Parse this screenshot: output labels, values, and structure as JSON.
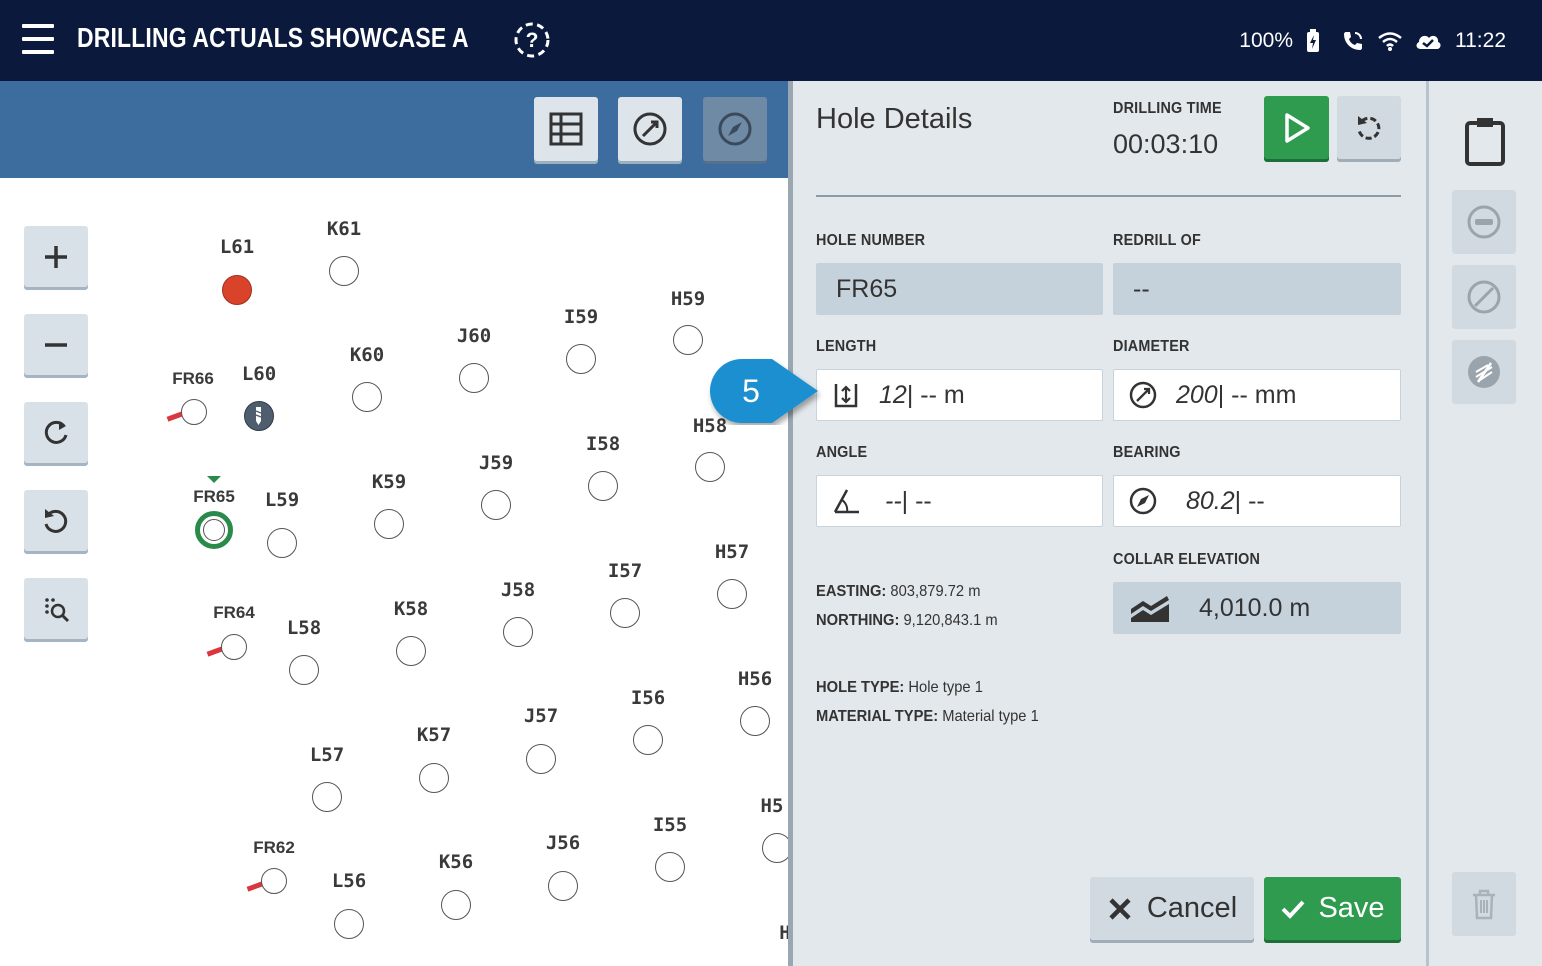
{
  "header": {
    "title": "DRILLING ACTUALS SHOWCASE A",
    "battery": "100%",
    "time": "11:22",
    "icons": [
      "menu-icon",
      "help-icon",
      "battery-icon",
      "phone-icon",
      "wifi-icon",
      "cloud-sync-icon"
    ]
  },
  "map": {
    "toolbar_icons": [
      "grid-icon",
      "diameter-icon",
      "compass-icon"
    ],
    "controls": [
      "zoom-in-icon",
      "zoom-out-icon",
      "redo-icon",
      "undo-icon",
      "zoom-search-icon"
    ],
    "holes": [
      {
        "label": "L61",
        "state": "drilled-red"
      },
      {
        "label": "K61"
      },
      {
        "label": "H59"
      },
      {
        "label": "I59"
      },
      {
        "label": "J60"
      },
      {
        "label": "K60"
      },
      {
        "label": "L60",
        "state": "drilling"
      },
      {
        "label": "FR66",
        "state": "redrill"
      },
      {
        "label": "H58"
      },
      {
        "label": "I58"
      },
      {
        "label": "J59"
      },
      {
        "label": "K59"
      },
      {
        "label": "L59"
      },
      {
        "label": "FR65",
        "state": "selected"
      },
      {
        "label": "H57"
      },
      {
        "label": "I57"
      },
      {
        "label": "J58"
      },
      {
        "label": "K58"
      },
      {
        "label": "L58"
      },
      {
        "label": "FR64",
        "state": "redrill"
      },
      {
        "label": "H56"
      },
      {
        "label": "I56"
      },
      {
        "label": "J57"
      },
      {
        "label": "K57"
      },
      {
        "label": "L57"
      },
      {
        "label": "H5"
      },
      {
        "label": "I55"
      },
      {
        "label": "J56"
      },
      {
        "label": "K56"
      },
      {
        "label": "L56"
      },
      {
        "label": "FR62",
        "state": "redrill"
      },
      {
        "label": "H"
      }
    ]
  },
  "panel": {
    "title": "Hole Details",
    "drilling_time_caption": "DRILLING TIME",
    "drilling_time": "00:03:10",
    "hole_number_caption": "HOLE NUMBER",
    "hole_number": "FR65",
    "redrill_caption": "REDRILL OF",
    "redrill": "--",
    "length_caption": "LENGTH",
    "length_value": "12",
    "length_rest": " | -- m",
    "diameter_caption": "DIAMETER",
    "diameter_value": "200",
    "diameter_rest": " | -- mm",
    "angle_caption": "ANGLE",
    "angle_value": "--",
    "angle_rest": " | --",
    "bearing_caption": "BEARING",
    "bearing_value": "80.2",
    "bearing_rest": " | --",
    "collar_caption": "COLLAR ELEVATION",
    "collar_value": "4,010.0 m",
    "easting_label": "EASTING:",
    "easting_value": "803,879.72 m",
    "northing_label": "NORTHING:",
    "northing_value": "9,120,843.1 m",
    "hole_type_label": "HOLE TYPE:",
    "hole_type_value": "Hole type 1",
    "material_type_label": "MATERIAL TYPE:",
    "material_type_value": "Material type 1",
    "cancel_label": "Cancel",
    "save_label": "Save"
  },
  "callout": {
    "number": "5"
  },
  "right_rail": {
    "icons": [
      "clipboard-icon",
      "minus-circle-icon",
      "forbidden-icon",
      "no-signal-icon",
      "trash-icon"
    ]
  },
  "colors": {
    "topbar": "#0b1a3c",
    "map_toolbar": "#3d6d9e",
    "accent_green": "#2e9b4f",
    "drilled_red": "#d9432a",
    "callout_blue": "#1a8fd0"
  }
}
